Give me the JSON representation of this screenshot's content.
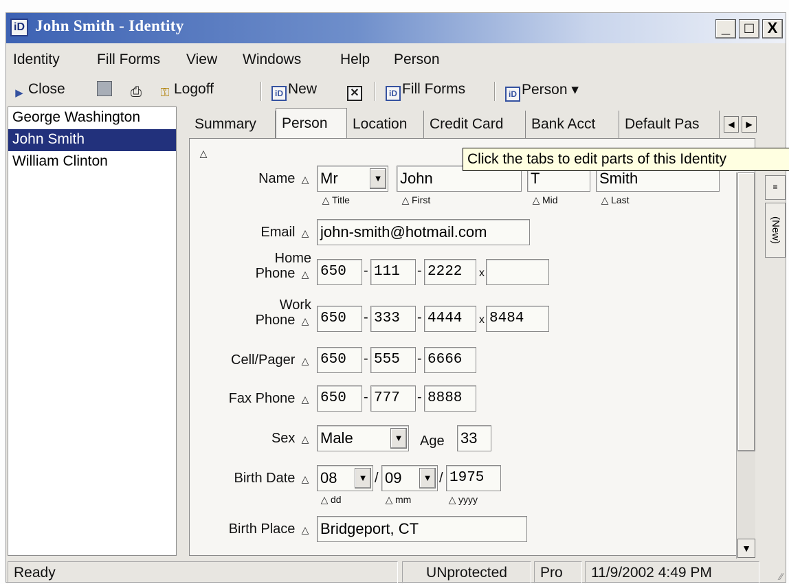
{
  "window": {
    "app_icon": "iD",
    "title": "John Smith - Identity",
    "controls": {
      "minimize": "_",
      "maximize": "□",
      "close": "X"
    }
  },
  "menu": [
    "Identity",
    "Fill Forms",
    "View",
    "Windows",
    "Help",
    "Person"
  ],
  "toolbar": {
    "close_label": "Close",
    "logoff_label": "Logoff",
    "new_label": "New",
    "fill_forms_label": "Fill Forms",
    "person_label": "Person ▾"
  },
  "persons": [
    "George Washington",
    "John Smith",
    "William Clinton"
  ],
  "selected_person": "John Smith",
  "tabs": [
    "Summary",
    "Person",
    "Location",
    "Credit Card",
    "Bank Acct",
    "Default Pas"
  ],
  "active_tab": "Person",
  "tooltip": "Click the tabs to edit parts of this Identity",
  "side_tab": "(New)",
  "form": {
    "name": {
      "label": "Name",
      "title": "Mr",
      "first": "John",
      "mid": "T",
      "last": "Smith",
      "sub_title": "Title",
      "sub_first": "First",
      "sub_mid": "Mid",
      "sub_last": "Last"
    },
    "email": {
      "label": "Email",
      "value": "john-smith@hotmail.com"
    },
    "home_phone": {
      "label_1": "Home",
      "label_2": "Phone",
      "area": "650",
      "prefix": "111",
      "line": "2222",
      "ext": ""
    },
    "work_phone": {
      "label_1": "Work",
      "label_2": "Phone",
      "area": "650",
      "prefix": "333",
      "line": "4444",
      "ext": "8484"
    },
    "cell": {
      "label": "Cell/Pager",
      "area": "650",
      "prefix": "555",
      "line": "6666"
    },
    "fax": {
      "label": "Fax Phone",
      "area": "650",
      "prefix": "777",
      "line": "8888"
    },
    "sex": {
      "label": "Sex",
      "value": "Male"
    },
    "age": {
      "label": "Age",
      "value": "33"
    },
    "birth_date": {
      "label": "Birth Date",
      "dd": "08",
      "mm": "09",
      "yyyy": "1975",
      "sub_dd": "dd",
      "sub_mm": "mm",
      "sub_yyyy": "yyyy"
    },
    "birth_place": {
      "label": "Birth Place",
      "value": "Bridgeport, CT"
    }
  },
  "status": {
    "text": "Ready",
    "protection": "UNprotected",
    "edition": "Pro",
    "datetime": "11/9/2002 4:49 PM"
  }
}
